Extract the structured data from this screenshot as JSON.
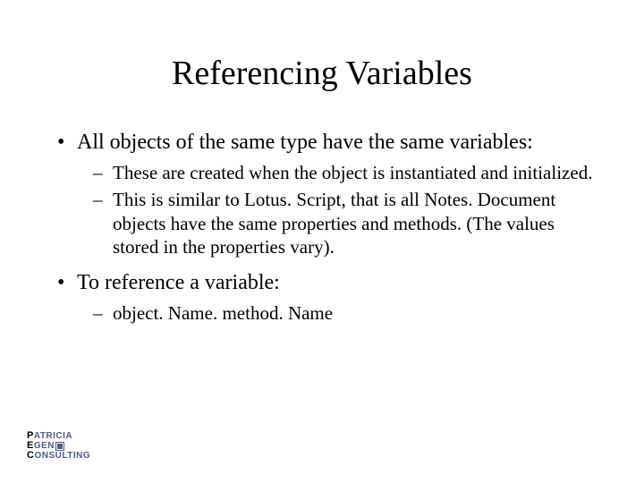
{
  "slide": {
    "title": "Referencing Variables",
    "bullets": {
      "b1": "All objects of the same type have the same variables:",
      "b1_1": "These are created when the object is instantiated and initialized.",
      "b1_2": "This is similar to Lotus. Script, that is all Notes. Document objects have the same properties and methods.  (The values stored in the properties vary).",
      "b2": "To reference a variable:",
      "b2_1": "object. Name. method. Name"
    }
  },
  "logo": {
    "line1_first": "P",
    "line1_rest": "ATRICIA",
    "line2_first": "E",
    "line2_rest": "GEN",
    "line3_first": "C",
    "line3_rest": "ONSULTING"
  }
}
